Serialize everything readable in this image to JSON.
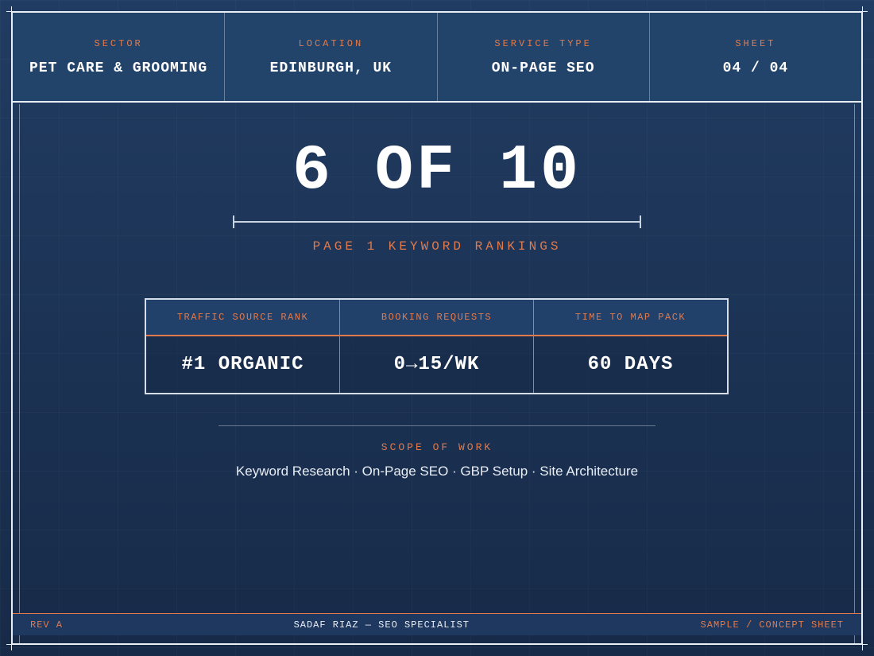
{
  "header": {
    "cells": [
      {
        "label": "SECTOR",
        "value": "PET CARE & GROOMING"
      },
      {
        "label": "LOCATION",
        "value": "EDINBURGH, UK"
      },
      {
        "label": "SERVICE TYPE",
        "value": "ON-PAGE SEO"
      },
      {
        "label": "SHEET",
        "value": "04 / 04"
      }
    ]
  },
  "hero": {
    "headline": "6 OF 10",
    "subtitle": "PAGE 1 KEYWORD RANKINGS"
  },
  "metrics": [
    {
      "label": "TRAFFIC SOURCE RANK",
      "value": "#1 ORGANIC"
    },
    {
      "label": "BOOKING REQUESTS",
      "value": "0→15/WK"
    },
    {
      "label": "TIME TO MAP PACK",
      "value": "60 DAYS"
    }
  ],
  "scope": {
    "label": "SCOPE OF WORK",
    "items": "Keyword Research · On-Page SEO · GBP Setup · Site Architecture"
  },
  "footer": {
    "left": "REV A",
    "center": "SADAF RIAZ — SEO SPECIALIST",
    "right": "SAMPLE / CONCEPT SHEET"
  },
  "colors": {
    "background": "#1c3255",
    "accent": "#e07a4c",
    "text": "#ffffff"
  }
}
